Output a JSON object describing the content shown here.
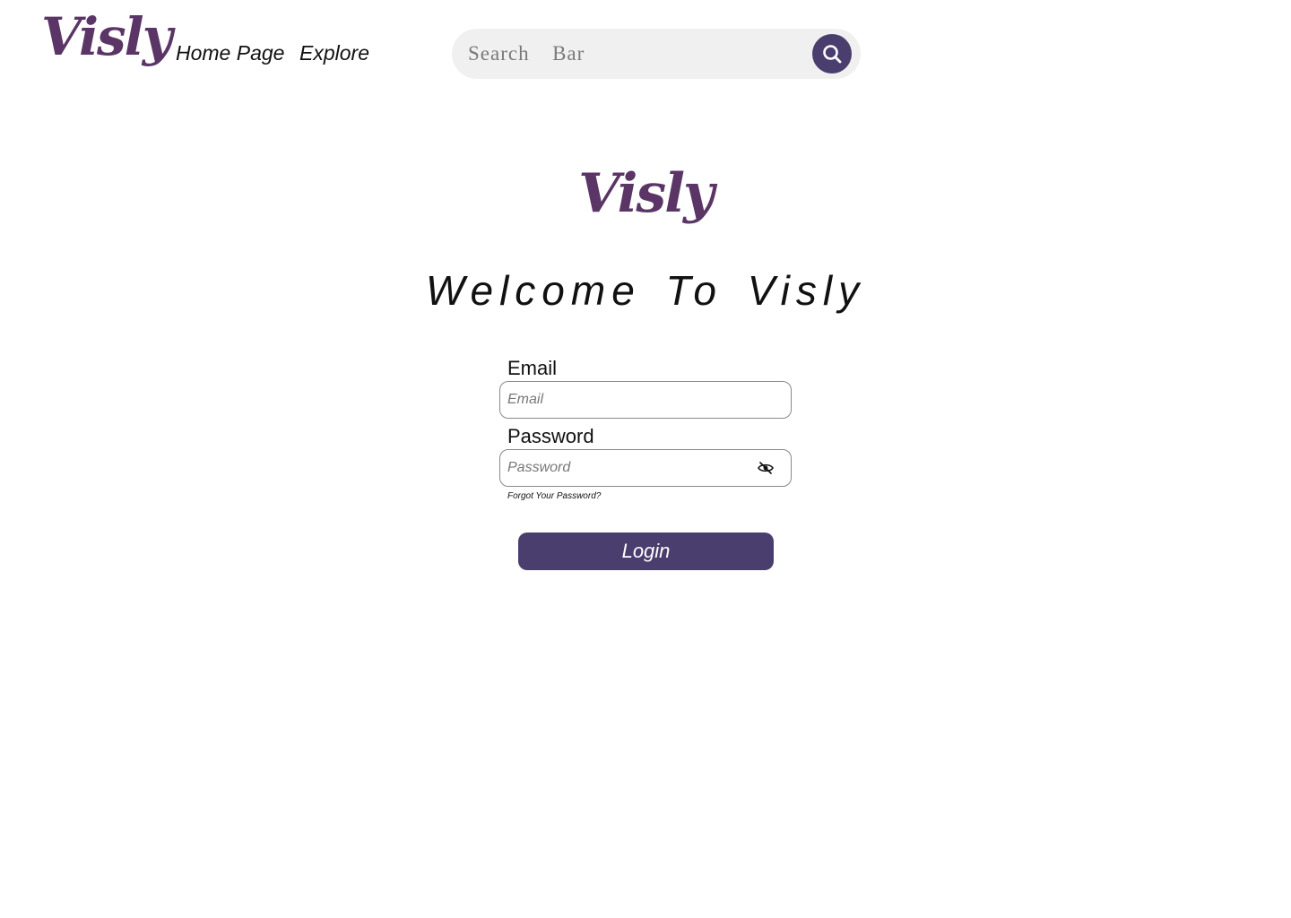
{
  "brand": {
    "name": "Visly",
    "logo_color": "#5a3566",
    "accent_color": "#4a3e6e"
  },
  "header": {
    "nav": [
      {
        "label": "Home Page"
      },
      {
        "label": "Explore"
      }
    ],
    "search": {
      "placeholder": "Search  Bar",
      "button_icon": "search-icon"
    }
  },
  "main": {
    "logo_text": "Visly",
    "title": "Welcome To Visly",
    "form": {
      "email_label": "Email",
      "email_placeholder": "Email",
      "password_label": "Password",
      "password_placeholder": "Password",
      "password_toggle_icon": "eye-slash-icon",
      "forgot_link": "Forgot Your Password?",
      "login_label": "Login"
    }
  }
}
